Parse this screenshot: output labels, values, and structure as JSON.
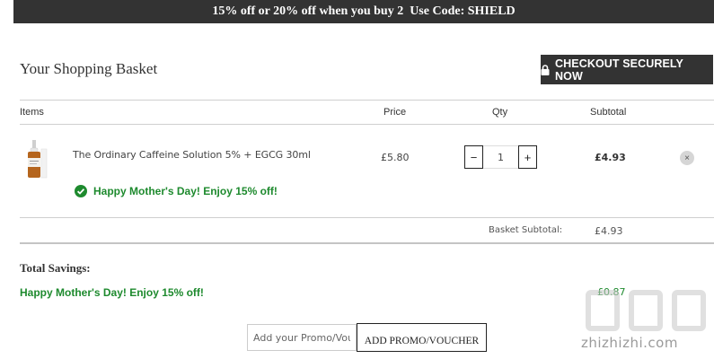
{
  "banner": {
    "text": "15% off or 20% off when you buy 2  Use Code: SHIELD"
  },
  "page": {
    "title": "Your Shopping Basket"
  },
  "checkout": {
    "label": "CHECKOUT SECURELY NOW",
    "icon": "lock-icon"
  },
  "table": {
    "headers": {
      "items": "Items",
      "price": "Price",
      "qty": "Qty",
      "subtotal": "Subtotal"
    }
  },
  "item": {
    "name": "The Ordinary Caffeine Solution 5% + EGCG 30ml",
    "price": "£5.80",
    "qty": "1",
    "qty_minus": "−",
    "qty_plus": "+",
    "subtotal": "£4.93",
    "remove": "×",
    "offer": "Happy Mother's Day! Enjoy 15% off!"
  },
  "basket": {
    "subtotal_label": "Basket Subtotal:",
    "subtotal_value": "£4.93"
  },
  "savings": {
    "title": "Total Savings:",
    "offer": "Happy Mother's Day! Enjoy 15% off!",
    "value": "£0.87"
  },
  "voucher": {
    "placeholder": "Add your Promo/Voucher code",
    "button": "ADD PROMO/VOUCHER"
  },
  "watermark": {
    "text": "zhizhizhi.com"
  },
  "colors": {
    "dark": "#333333",
    "green": "#1e8a2e",
    "rule": "#cfcfcf"
  }
}
